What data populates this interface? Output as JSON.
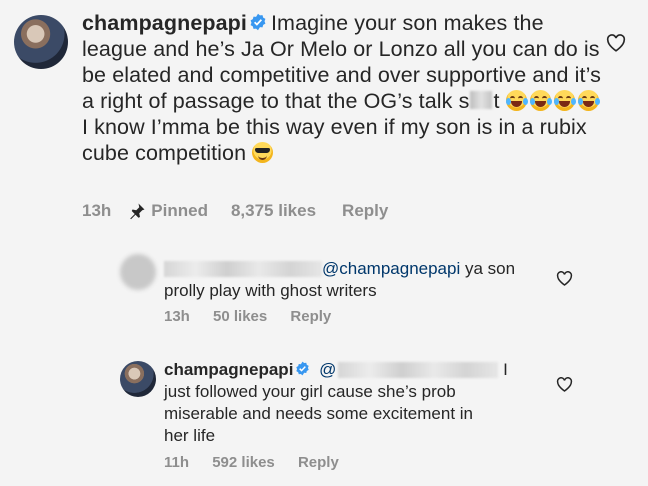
{
  "main_comment": {
    "username": "champagnepapi",
    "text_part1": "Imagine your son makes the league and he’s Ja Or Melo or Lonzo all you can do is be elated and competitive and over supportive and it’s a right of passage to that the OG’s talk s",
    "text_part2": "t",
    "text_part3": "I know I’mma be this way even if my son is in a rubix cube competition",
    "time": "13h",
    "pinned_label": "Pinned",
    "likes": "8,375 likes",
    "reply_label": "Reply",
    "emojis": [
      "face-with-tears-of-joy",
      "face-with-tears-of-joy",
      "face-with-tears-of-joy",
      "face-with-tears-of-joy",
      "smiling-face-with-sunglasses"
    ]
  },
  "reply_1": {
    "mention": "@champagnepapi",
    "text_line1": "ya son",
    "text_line2": "prolly play with ghost writers",
    "time": "13h",
    "likes": "50 likes",
    "reply_label": "Reply"
  },
  "reply_2": {
    "username": "champagnepapi",
    "mention_prefix": "@",
    "text_after_mention": "I",
    "text_line2": "just followed your girl cause she’s prob",
    "text_line3": "miserable and needs some excitement in",
    "text_line4": "her life",
    "time": "11h",
    "likes": "592 likes",
    "reply_label": "Reply"
  },
  "colors": {
    "background": "#f4f4f4",
    "text": "#262626",
    "meta": "#8e8e8e",
    "mention": "#00376b",
    "verified": "#3897f0"
  }
}
